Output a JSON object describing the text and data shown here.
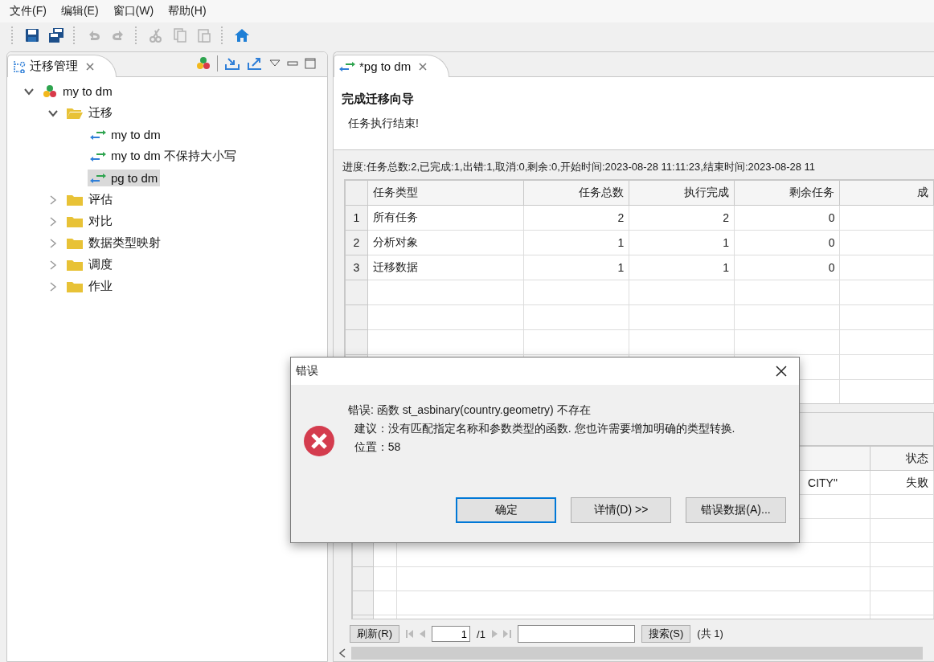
{
  "menu_bar": [
    {
      "label": "文件(F)"
    },
    {
      "label": "编辑(E)"
    },
    {
      "label": "窗口(W)"
    },
    {
      "label": "帮助(H)"
    }
  ],
  "toolbar": [
    {
      "kind": "save",
      "disabled": false
    },
    {
      "kind": "save_all",
      "disabled": false
    },
    {
      "kind": "sep"
    },
    {
      "kind": "undo",
      "disabled": true
    },
    {
      "kind": "redo",
      "disabled": true
    },
    {
      "kind": "sep"
    },
    {
      "kind": "cut",
      "disabled": true
    },
    {
      "kind": "copy",
      "disabled": true
    },
    {
      "kind": "paste",
      "disabled": true
    },
    {
      "kind": "sep"
    },
    {
      "kind": "home",
      "disabled": false
    }
  ],
  "left_view": {
    "tab": {
      "title": "迁移管理",
      "selected": true
    },
    "tree": [
      {
        "label": "my to dm",
        "kind": "project",
        "expanded": true,
        "selected": false,
        "children": [
          {
            "label": "迁移",
            "kind": "folder",
            "expanded": true,
            "selected": false,
            "children": [
              {
                "label": "my to dm",
                "kind": "task",
                "selected": false
              },
              {
                "label": "my to dm 不保持大小写",
                "kind": "task",
                "selected": false
              },
              {
                "label": "pg to dm",
                "kind": "task",
                "selected": true
              }
            ]
          },
          {
            "label": "评估",
            "kind": "folder",
            "expanded": false,
            "selected": false
          },
          {
            "label": "对比",
            "kind": "folder",
            "expanded": false,
            "selected": false
          },
          {
            "label": "数据类型映射",
            "kind": "folder",
            "expanded": false,
            "selected": false
          },
          {
            "label": "调度",
            "kind": "folder",
            "expanded": false,
            "selected": false
          },
          {
            "label": "作业",
            "kind": "folder",
            "expanded": false,
            "selected": false
          }
        ]
      }
    ]
  },
  "editor": {
    "tab": {
      "title": "*pg to dm",
      "selected": true
    },
    "heading": "完成迁移向导",
    "message": "任务执行结束!",
    "progress": "进度:任务总数:2,已完成:1,出错:1,取消:0,剩余:0,开始时间:2023-08-28 11:11:23,结束时间:2023-08-28 11",
    "summary_table": {
      "columns": [
        "任务类型",
        "任务总数",
        "执行完成",
        "剩余任务",
        "成"
      ],
      "rows": [
        {
          "number": "1",
          "cells": [
            "所有任务",
            "2",
            "2",
            "0",
            ""
          ]
        },
        {
          "number": "2",
          "cells": [
            "分析对象",
            "1",
            "1",
            "0",
            ""
          ]
        },
        {
          "number": "3",
          "cells": [
            "迁移数据",
            "1",
            "1",
            "0",
            ""
          ]
        }
      ]
    },
    "detail_table": {
      "columns": [
        "",
        "状态"
      ],
      "rows": [
        {
          "cells": [
            "CITY\"",
            "失败"
          ]
        }
      ]
    },
    "pager": {
      "refresh": "刷新(R)",
      "page": "1",
      "total_pages": "/1",
      "search": "搜索(S)",
      "count": "(共 1)"
    }
  },
  "dialog": {
    "title": "错误",
    "lines": [
      "错误: 函数 st_asbinary(country.geometry) 不存在",
      "  建议：没有匹配指定名称和参数类型的函数. 您也许需要增加明确的类型转换.",
      "  位置：58"
    ],
    "buttons": [
      {
        "label": "确定",
        "default": true
      },
      {
        "label": "详情(D) >>",
        "default": false
      },
      {
        "label": "错误数据(A)...",
        "default": false
      }
    ]
  }
}
